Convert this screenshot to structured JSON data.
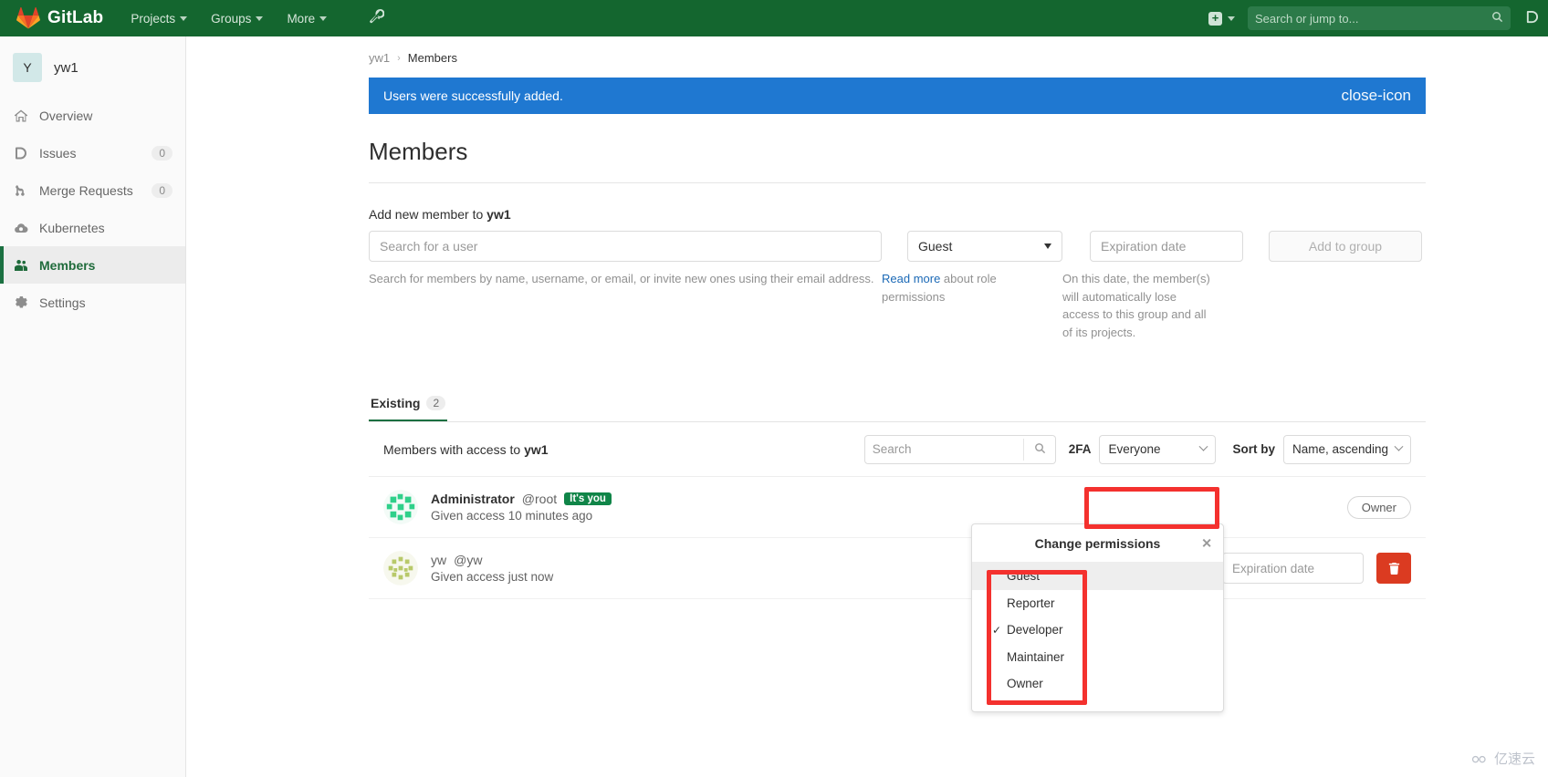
{
  "topbar": {
    "brand": "GitLab",
    "nav": [
      {
        "label": "Projects",
        "icon": "chevron-down-icon"
      },
      {
        "label": "Groups",
        "icon": "chevron-down-icon"
      },
      {
        "label": "More",
        "icon": "chevron-down-icon"
      }
    ],
    "wrench_icon": "wrench-icon",
    "plus_icon": "plus-square-icon",
    "search_placeholder": "Search or jump to...",
    "search_icon": "search-icon",
    "issues_icon": "issues-icon",
    "background_color": "#14662f"
  },
  "sidebar": {
    "avatar_initial": "Y",
    "group_name": "yw1",
    "items": [
      {
        "label": "Overview",
        "icon": "home-icon",
        "badge": "",
        "active": false
      },
      {
        "label": "Issues",
        "icon": "issues-icon",
        "badge": "0",
        "active": false
      },
      {
        "label": "Merge Requests",
        "icon": "merge-request-icon",
        "badge": "0",
        "active": false
      },
      {
        "label": "Kubernetes",
        "icon": "kubernetes-icon",
        "badge": "",
        "active": false
      },
      {
        "label": "Members",
        "icon": "users-icon",
        "badge": "",
        "active": true
      },
      {
        "label": "Settings",
        "icon": "gear-icon",
        "badge": "",
        "active": false
      }
    ]
  },
  "breadcrumb": {
    "root": "yw1",
    "separator": "›",
    "current": "Members"
  },
  "alert": {
    "message": "Users were successfully added.",
    "close_icon": "close-icon",
    "color": "#1f78d1"
  },
  "page": {
    "title": "Members"
  },
  "add_member": {
    "label_prefix": "Add new member to ",
    "label_group": "yw1",
    "user_placeholder": "Search for a user",
    "user_help": "Search for members by name, username, or email, or invite new ones using their email address.",
    "role_value": "Guest",
    "role_help_link": "Read more",
    "role_help_rest": " about role permissions",
    "expiration_placeholder": "Expiration date",
    "expiration_help": "On this date, the member(s) will automatically lose access to this group and all of its projects.",
    "submit_label": "Add to group"
  },
  "tabs": [
    {
      "label": "Existing",
      "count": "2",
      "active": true
    }
  ],
  "members_panel": {
    "heading_prefix": "Members with access to ",
    "heading_group": "yw1",
    "search_placeholder": "Search",
    "search_icon": "search-icon",
    "twofa_label": "2FA",
    "twofa_value": "Everyone",
    "sort_label": "Sort by",
    "sort_value": "Name, ascending",
    "rows": [
      {
        "name": "Administrator",
        "username": "@root",
        "badge": "It's you",
        "access_text": "Given access 10 minutes ago",
        "role_display": "Owner",
        "role_type": "pill",
        "avatar_color": "#2fd08a"
      },
      {
        "name": "yw",
        "username": "@yw",
        "badge": "",
        "access_text": "Given access just now",
        "role_display": "Developer",
        "role_type": "select",
        "expiration_placeholder": "Expiration date",
        "delete_icon": "trash-icon",
        "avatar_color": "#b8c96a"
      }
    ]
  },
  "permissions_dropdown": {
    "title": "Change permissions",
    "close_icon": "close-icon",
    "options": [
      {
        "label": "Guest",
        "selected": false,
        "hovered": true
      },
      {
        "label": "Reporter",
        "selected": false,
        "hovered": false
      },
      {
        "label": "Developer",
        "selected": true,
        "hovered": false
      },
      {
        "label": "Maintainer",
        "selected": false,
        "hovered": false
      },
      {
        "label": "Owner",
        "selected": false,
        "hovered": false
      }
    ],
    "check_glyph": "✓",
    "highlight_color": "#f4312e"
  },
  "watermark": {
    "text": "亿速云",
    "icon": "cloud-icon"
  }
}
